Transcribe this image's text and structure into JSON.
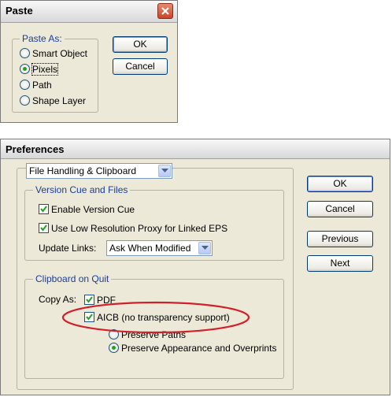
{
  "paste_dialog": {
    "title": "Paste",
    "group_label": "Paste As:",
    "options": [
      "Smart Object",
      "Pixels",
      "Path",
      "Shape Layer"
    ],
    "selected_option": "Pixels",
    "ok_label": "OK",
    "cancel_label": "Cancel"
  },
  "preferences_dialog": {
    "title": "Preferences",
    "section_select": "File Handling & Clipboard",
    "version_cue": {
      "group_label": "Version Cue and Files",
      "enable_version_cue": "Enable Version Cue",
      "use_low_res_proxy": "Use Low Resolution Proxy for Linked EPS",
      "update_links_label": "Update Links:",
      "update_links_value": "Ask When Modified"
    },
    "clipboard": {
      "group_label": "Clipboard on Quit",
      "copy_as_label": "Copy As:",
      "pdf": "PDF",
      "aicb": "AICB (no transparency support)",
      "preserve_paths": "Preserve Paths",
      "preserve_appearance": "Preserve Appearance and Overprints"
    },
    "buttons": {
      "ok": "OK",
      "cancel": "Cancel",
      "previous": "Previous",
      "next": "Next"
    }
  },
  "annotation_color": "#d0202a",
  "accent_color": "#21a121"
}
